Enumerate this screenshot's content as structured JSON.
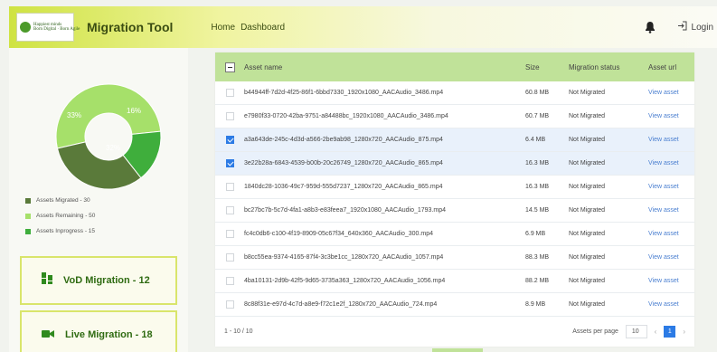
{
  "header": {
    "logo_line1": "Happiest minds",
    "logo_line2": "Born Digital · Born Agile",
    "app_title": "Migration Tool",
    "nav": [
      "Home",
      "Dashboard"
    ],
    "login_label": "Login",
    "icons": {
      "bell": "bell-icon",
      "login": "login-icon"
    }
  },
  "sidebar": {
    "donut": {
      "labels": [
        "33%",
        "16%",
        "32%"
      ],
      "slices": [
        {
          "name": "Assets Remaining",
          "percent": 52,
          "color": "#a6e06a"
        },
        {
          "name": "Assets Inprogress",
          "percent": 16,
          "color": "#3fae3c"
        },
        {
          "name": "Assets Migrated",
          "percent": 32,
          "color": "#5a7a3a"
        }
      ]
    },
    "legend": [
      {
        "label": "Assets Migrated - 30",
        "color": "#5a7a3a"
      },
      {
        "label": "Assets Remaining - 50",
        "color": "#a6e06a"
      },
      {
        "label": "Assets Inprogress - 15",
        "color": "#3fae3c"
      }
    ],
    "cards": [
      {
        "label": "VoD Migration - 12",
        "icon": "people-icon"
      },
      {
        "label": "Live Migration - 18",
        "icon": "video-camera-icon"
      }
    ]
  },
  "table": {
    "columns": [
      "Asset name",
      "Size",
      "Migration status",
      "Asset url"
    ],
    "rows": [
      {
        "name": "b44944ff-7d2d-4f25-86f1-6bbd7330_1920x1080_AACAudio_3486.mp4",
        "size": "60.8 MB",
        "status": "Not Migrated",
        "url": "View asset",
        "selected": false
      },
      {
        "name": "e7980f33-0720-42ba-9751-a84488bc_1920x1080_AACAudio_3486.mp4",
        "size": "60.7 MB",
        "status": "Not Migrated",
        "url": "View asset",
        "selected": false
      },
      {
        "name": "a3a643de-245c-4d3d-a566-2be9ab98_1280x720_AACAudio_875.mp4",
        "size": "6.4 MB",
        "status": "Not Migrated",
        "url": "View asset",
        "selected": true
      },
      {
        "name": "3e22b28a-6843-4539-b00b-20c26749_1280x720_AACAudio_865.mp4",
        "size": "16.3 MB",
        "status": "Not Migrated",
        "url": "View asset",
        "selected": true
      },
      {
        "name": "1840dc28-1036-49c7-959d-555d7237_1280x720_AACAudio_865.mp4",
        "size": "16.3 MB",
        "status": "Not Migrated",
        "url": "View asset",
        "selected": false
      },
      {
        "name": "bc27bc7b-5c7d-4fa1-a8b3-e83feea7_1920x1080_AACAudio_1793.mp4",
        "size": "14.5 MB",
        "status": "Not Migrated",
        "url": "View asset",
        "selected": false
      },
      {
        "name": "fc4c0db6-c100-4f19-8909-05c67f34_640x360_AACAudio_300.mp4",
        "size": "6.9 MB",
        "status": "Not Migrated",
        "url": "View asset",
        "selected": false
      },
      {
        "name": "b8cc55ea-9374-4165-87f4-3c3be1cc_1280x720_AACAudio_1057.mp4",
        "size": "88.3 MB",
        "status": "Not Migrated",
        "url": "View asset",
        "selected": false
      },
      {
        "name": "4ba10131-2d9b-42f5-9d65-3735a363_1280x720_AACAudio_1056.mp4",
        "size": "88.2 MB",
        "status": "Not Migrated",
        "url": "View asset",
        "selected": false
      },
      {
        "name": "8c88f31e-e97d-4c7d-a8e9-f72c1e2f_1280x720_AACAudio_724.mp4",
        "size": "8.9 MB",
        "status": "Not Migrated",
        "url": "View asset",
        "selected": false
      }
    ]
  },
  "footer": {
    "range": "1 - 10 / 10",
    "per_page_label": "Assets per page",
    "per_page_value": "10",
    "current_page": "1",
    "prev": "‹",
    "next": "›"
  }
}
